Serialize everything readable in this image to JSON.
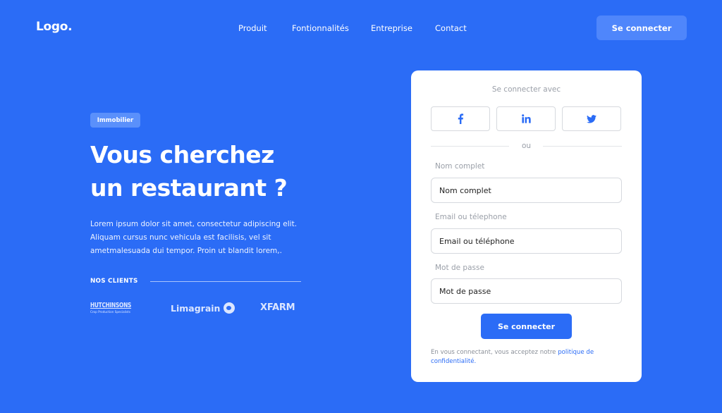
{
  "header": {
    "logo": "Logo.",
    "nav": [
      "Produit",
      "Fontionnalités",
      "Entreprise",
      "Contact"
    ],
    "login_button": "Se connecter"
  },
  "hero": {
    "badge": "Immobilier",
    "title_line1": "Vous cherchez",
    "title_line2": "un restaurant ?",
    "description": "Lorem ipsum dolor sit amet, consectetur adipiscing elit. Aliquam cursus nunc vehicula est facilisis, vel sit ametmalesuada dui tempor. Proin ut blandit lorem,.",
    "clients_label": "NOS CLIENTS",
    "clients": {
      "hutchinsons": "HUTCHINSONS",
      "hutchinsons_tagline": "Crop Production Specialists",
      "limagrain": "Limagrain",
      "xfarm": "XFARM"
    }
  },
  "card": {
    "subtitle": "Se connecter avec",
    "social": [
      {
        "name": "facebook",
        "icon": "facebook-icon"
      },
      {
        "name": "linkedin",
        "icon": "linkedin-icon"
      },
      {
        "name": "twitter",
        "icon": "twitter-icon"
      }
    ],
    "or": "ou",
    "fields": {
      "name_label": "Nom complet",
      "name_placeholder": "Nom complet",
      "contact_label": "Email ou télephone",
      "contact_placeholder": "Email ou téléphone",
      "password_label": "Mot de passe",
      "password_placeholder": "Mot de passe"
    },
    "submit": "Se connecter",
    "legal_prefix": "En vous connectant, vous acceptez notre ",
    "legal_link": "politique de confidentialité."
  },
  "colors": {
    "background": "#2b6cf6",
    "accent": "#2b6cf6",
    "header_button": "#4f86fb",
    "card": "#ffffff"
  }
}
